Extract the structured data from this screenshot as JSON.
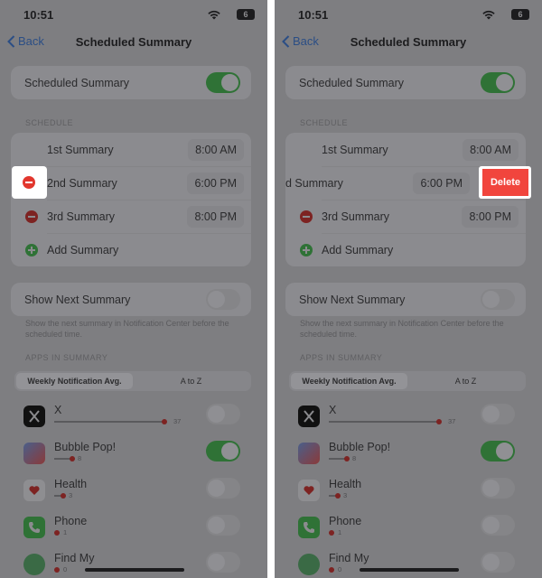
{
  "status": {
    "time": "10:51",
    "battery": "6"
  },
  "nav": {
    "back": "Back",
    "title": "Scheduled Summary"
  },
  "scheduled_summary": {
    "label": "Scheduled Summary",
    "enabled": true
  },
  "schedule": {
    "header": "SCHEDULE",
    "summaries": [
      {
        "label": "1st Summary",
        "time": "8:00 AM"
      },
      {
        "label": "2nd Summary",
        "time": "6:00 PM"
      },
      {
        "label": "3rd Summary",
        "time": "8:00 PM"
      }
    ],
    "add_label": "Add Summary",
    "swiped_label": "d Summary",
    "delete_label": "Delete"
  },
  "show_next": {
    "label": "Show Next Summary",
    "enabled": false,
    "footnote": "Show the next summary in Notification Center before the scheduled time."
  },
  "apps": {
    "header": "APPS IN SUMMARY",
    "segments": [
      "Weekly Notification Avg.",
      "A to Z"
    ],
    "active_segment": 0,
    "items": [
      {
        "name": "X",
        "count": "37",
        "level": 0.98,
        "enabled": false,
        "icon": "x-logo-icon"
      },
      {
        "name": "Bubble Pop!",
        "count": "8",
        "level": 0.2,
        "enabled": true,
        "icon": "bubble-pop-icon"
      },
      {
        "name": "Health",
        "count": "3",
        "level": 0.08,
        "enabled": false,
        "icon": "heart-icon"
      },
      {
        "name": "Phone",
        "count": "1",
        "level": 0.03,
        "enabled": false,
        "icon": "phone-icon"
      },
      {
        "name": "Find My",
        "count": "0",
        "level": 0.01,
        "enabled": false,
        "icon": "find-my-icon"
      }
    ]
  },
  "colors": {
    "dim_background": "#7e7e81",
    "toggle_on": "#2f7236",
    "delete_red": "#f1453d",
    "remove_red": "#e2372e",
    "link_blue": "#2b4e85"
  }
}
